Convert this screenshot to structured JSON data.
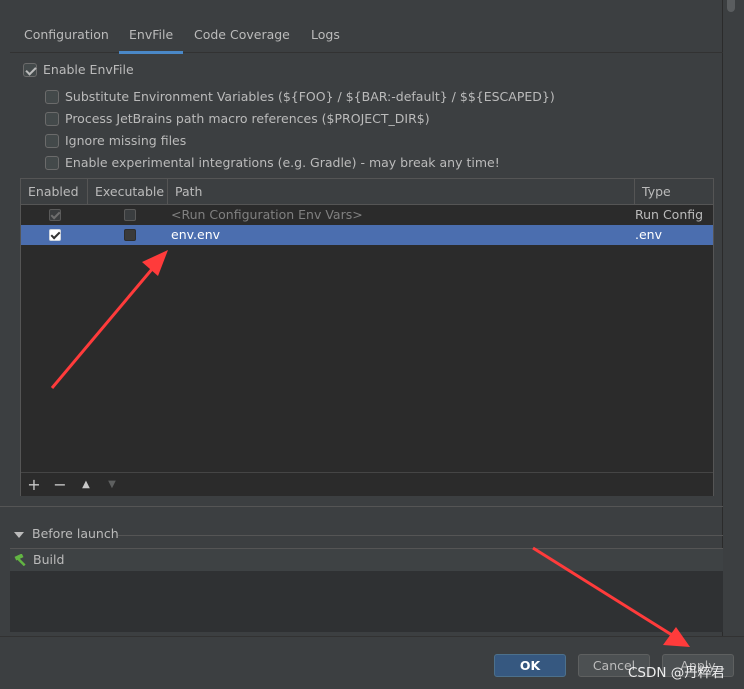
{
  "tabs": [
    {
      "label": "Configuration"
    },
    {
      "label": "EnvFile",
      "active": true
    },
    {
      "label": "Code Coverage"
    },
    {
      "label": "Logs"
    }
  ],
  "enable_envfile": {
    "label": "Enable EnvFile",
    "checked": true
  },
  "options": [
    {
      "label": "Substitute Environment Variables (${FOO} / ${BAR:-default} / $${ESCAPED})",
      "checked": false
    },
    {
      "label": "Process JetBrains path macro references ($PROJECT_DIR$)",
      "checked": false
    },
    {
      "label": "Ignore missing files",
      "checked": false
    },
    {
      "label": "Enable experimental integrations (e.g. Gradle) - may break any time!",
      "checked": false
    }
  ],
  "table": {
    "columns": [
      "Enabled",
      "Executable",
      "Path",
      "Type"
    ],
    "rows": [
      {
        "enabled": true,
        "executable": false,
        "path": "<Run Configuration Env Vars>",
        "type": "Run Config",
        "selected": false,
        "dimmed": true
      },
      {
        "enabled": true,
        "executable": false,
        "path": "env.env",
        "type": ".env",
        "selected": true,
        "dimmed": false
      }
    ],
    "toolbar": [
      {
        "icon": "add-icon",
        "glyph": "+"
      },
      {
        "icon": "remove-icon",
        "glyph": "−"
      },
      {
        "icon": "move-up-icon",
        "glyph": "▲"
      },
      {
        "icon": "move-down-icon",
        "glyph": "▼"
      }
    ]
  },
  "before_launch": {
    "title": "Before launch",
    "items": [
      {
        "label": "Build",
        "icon": "hammer-icon"
      }
    ]
  },
  "buttons": {
    "ok": "OK",
    "cancel": "Cancel",
    "apply": "Apply"
  },
  "watermark": "CSDN @丹粹君",
  "colors": {
    "selection": "#4b6eaf",
    "accent": "#4a88c7",
    "arrow": "#ff3b3b"
  }
}
